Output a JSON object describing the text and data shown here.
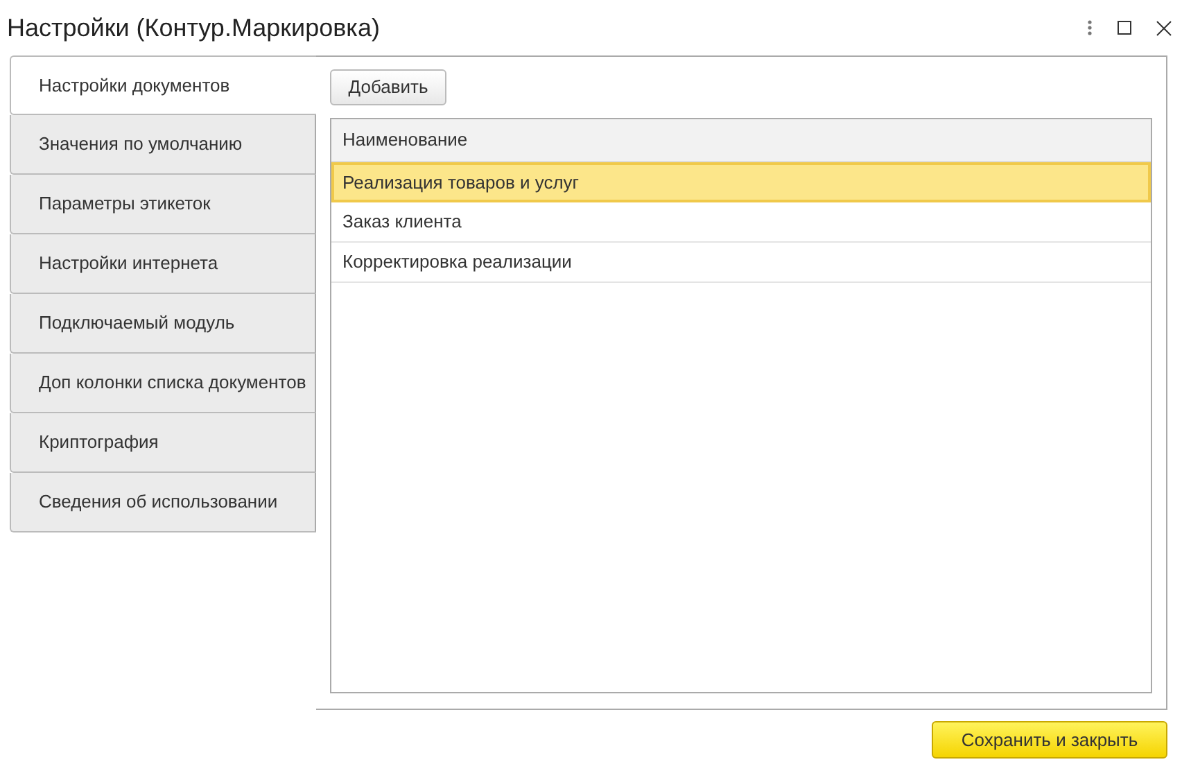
{
  "window": {
    "title": "Настройки (Контур.Маркировка)"
  },
  "tabs": [
    {
      "label": "Настройки документов",
      "selected": true
    },
    {
      "label": "Значения по умолчанию",
      "selected": false
    },
    {
      "label": "Параметры этикеток",
      "selected": false
    },
    {
      "label": "Настройки интернета",
      "selected": false
    },
    {
      "label": "Подключаемый модуль",
      "selected": false
    },
    {
      "label": "Доп колонки списка документов",
      "selected": false
    },
    {
      "label": "Криптография",
      "selected": false
    },
    {
      "label": "Сведения об использовании",
      "selected": false
    }
  ],
  "add_button": "Добавить",
  "table": {
    "columns": [
      "Наименование"
    ],
    "rows": [
      {
        "name": "Реализация товаров и услуг",
        "selected": true
      },
      {
        "name": "Заказ клиента",
        "selected": false
      },
      {
        "name": "Корректировка реализации",
        "selected": false
      }
    ]
  },
  "save_button": "Сохранить и закрыть"
}
